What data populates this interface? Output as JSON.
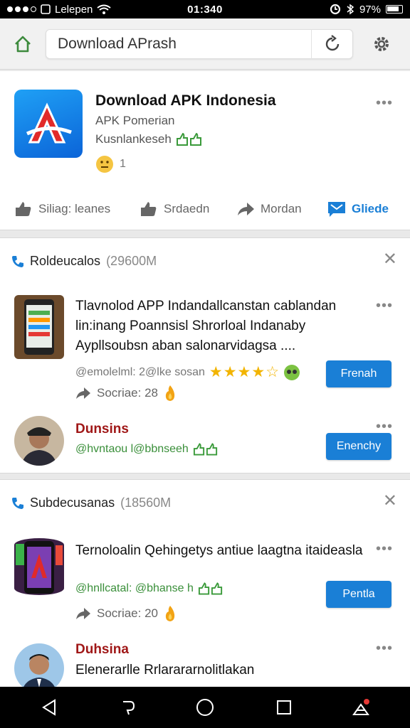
{
  "status": {
    "carrier": "Lelepen",
    "time": "01:340",
    "battery": "97%"
  },
  "browser": {
    "url_text": "Download APrash"
  },
  "app": {
    "title": "Download APK Indonesia",
    "subtitle": "APK Pomerian",
    "author": "Kusnlankeseh",
    "reaction_count": "1",
    "actions": {
      "like": "Siliag: leanes",
      "share": "Srdaedn",
      "forward": "Mordan",
      "guide": "Gliede"
    }
  },
  "section1": {
    "title": "Roldeucalos",
    "meta": "(29600M",
    "post1": {
      "text": "Tlavnolod APP Indandallcanstan cablandan lin:inang Poannsisl Shrorloal Indanaby Aypllsoubsn aban salonarvidagsa ....",
      "author": "@emolelml: 2@lke sosan",
      "score": "Socriae: 28",
      "button": "Frenah",
      "rating": 4
    },
    "post2": {
      "name": "Dunsins",
      "author": "@hvntaou l@bbnseeh",
      "button": "Enenchy"
    }
  },
  "section2": {
    "title": "Subdecusanas",
    "meta": "(18560M",
    "post1": {
      "text": "Ternoloalin Qehingetys antiue laagtna itaideasla",
      "author": "@hnllcatal: @bhanse h",
      "score": "Socriae: 20",
      "button": "Pentla"
    },
    "post2": {
      "name": "Duhsina",
      "text": "Elenerarlle Rrlarararnolitlakan"
    }
  },
  "colors": {
    "accent": "#1a7fd6",
    "author_name": "#a01818",
    "author_handle": "#3a8f3a"
  }
}
